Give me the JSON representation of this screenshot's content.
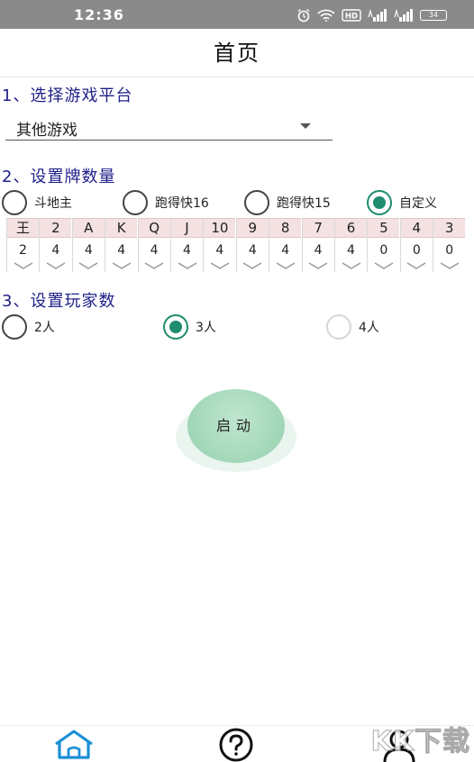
{
  "status_bar": {
    "time": "12:36",
    "battery": "34"
  },
  "header": {
    "title": "首页"
  },
  "sections": {
    "platform": {
      "title": "1、选择游戏平台",
      "selected": "其他游戏"
    },
    "card_count": {
      "title": "2、设置牌数量",
      "options": [
        {
          "label": "斗地主",
          "checked": false
        },
        {
          "label": "跑得快16",
          "checked": false
        },
        {
          "label": "跑得快15",
          "checked": false
        },
        {
          "label": "自定义",
          "checked": true
        }
      ],
      "cards": [
        {
          "rank": "王",
          "count": "2"
        },
        {
          "rank": "2",
          "count": "4"
        },
        {
          "rank": "A",
          "count": "4"
        },
        {
          "rank": "K",
          "count": "4"
        },
        {
          "rank": "Q",
          "count": "4"
        },
        {
          "rank": "J",
          "count": "4"
        },
        {
          "rank": "10",
          "count": "4"
        },
        {
          "rank": "9",
          "count": "4"
        },
        {
          "rank": "8",
          "count": "4"
        },
        {
          "rank": "7",
          "count": "4"
        },
        {
          "rank": "6",
          "count": "4"
        },
        {
          "rank": "5",
          "count": "0"
        },
        {
          "rank": "4",
          "count": "0"
        },
        {
          "rank": "3",
          "count": "0"
        }
      ]
    },
    "players": {
      "title": "3、设置玩家数",
      "options": [
        {
          "label": "2人",
          "checked": false
        },
        {
          "label": "3人",
          "checked": true
        },
        {
          "label": "4人",
          "checked": false
        }
      ]
    }
  },
  "start_button": {
    "label": "启动"
  },
  "bottom_nav": [
    {
      "icon": "home-icon",
      "active": true
    },
    {
      "icon": "help-icon",
      "active": false
    },
    {
      "icon": "user-icon",
      "active": false
    }
  ],
  "watermark": "KK下载",
  "colors": {
    "accent": "#1e8c6e",
    "section_title": "#1f1f8a",
    "nav_active": "#1a8fd6",
    "start_button": "#a6d9bb"
  }
}
